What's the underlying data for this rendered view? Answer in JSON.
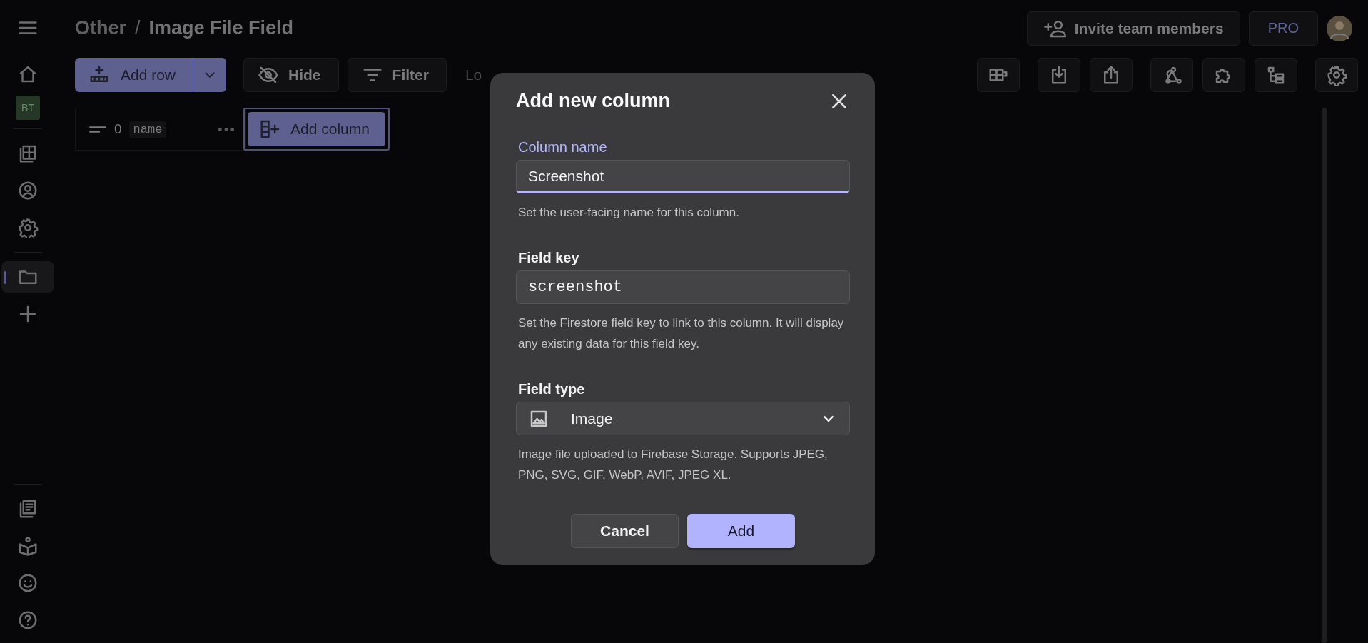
{
  "breadcrumb": [
    "Other",
    "Image File Field"
  ],
  "breadcrumb_separator": "/",
  "header": {
    "invite": "Invite team members",
    "plan": "PRO"
  },
  "sidebar": {
    "badge": "BT",
    "top": [
      {
        "kind": "home",
        "selected": false
      }
    ],
    "middle": [
      {
        "kind": "table",
        "selected": false
      },
      {
        "kind": "user",
        "selected": false
      },
      {
        "kind": "gear",
        "selected": false
      }
    ],
    "projects": [
      {
        "kind": "folder",
        "selected": true
      },
      {
        "kind": "plus",
        "selected": false
      }
    ],
    "bottom": [
      {
        "kind": "docs",
        "selected": false
      },
      {
        "kind": "learn",
        "selected": false
      },
      {
        "kind": "smile",
        "selected": false
      },
      {
        "kind": "help",
        "selected": false
      }
    ]
  },
  "toolbar": {
    "add_row": "Add row",
    "hide": "Hide",
    "filter": "Filter",
    "status": "Lo",
    "tools": [
      {
        "kind": "columns"
      },
      {
        "kind": "import"
      },
      {
        "kind": "export"
      },
      {
        "kind": "webhook"
      },
      {
        "kind": "extension"
      },
      {
        "kind": "tree"
      },
      {
        "kind": "gear"
      }
    ]
  },
  "columns_header": {
    "count": "0",
    "key": "name",
    "add_column": "Add column"
  },
  "dialog": {
    "title": "Add new column",
    "fields": [
      {
        "kind": "text",
        "label": "Column name",
        "value": "Screenshot",
        "focused": true,
        "helper": "Set the user-facing name for this column."
      },
      {
        "kind": "code",
        "label": "Field key",
        "value": "screenshot",
        "focused": false,
        "helper": "Set the Firestore field key to link to this column. It will display any existing data for this field key."
      },
      {
        "kind": "select",
        "label": "Field type",
        "value": "Image",
        "focused": false,
        "helper": "Image file uploaded to Firebase Storage. Supports JPEG, PNG, SVG, GIF, WebP, AVIF, JPEG XL."
      }
    ],
    "buttons": [
      {
        "label": "Cancel",
        "primary": false
      },
      {
        "label": "Add",
        "primary": true
      }
    ]
  }
}
